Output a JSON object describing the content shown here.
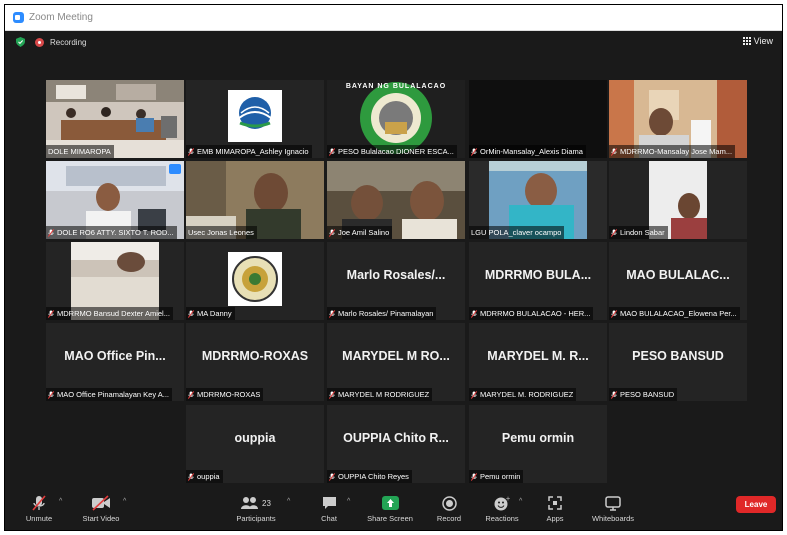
{
  "window": {
    "title": "Zoom Meeting"
  },
  "topbar": {
    "recording_label": "Recording",
    "view_label": "View"
  },
  "participants": [
    {
      "id": "p1",
      "name": "DOLE MIMAROPA",
      "muted": false,
      "display": "video"
    },
    {
      "id": "p2",
      "name": "EMB MIMAROPA_Ashley Ignacio",
      "muted": true,
      "display": "logo"
    },
    {
      "id": "p3",
      "name": "PESO Bulalacao DIONER ESCA...",
      "muted": true,
      "display": "logo",
      "logo_text": "BAYAN NG BULALACAO"
    },
    {
      "id": "p4",
      "name": "OrMin-Mansalay_Alexis Diama",
      "muted": true,
      "display": "blank"
    },
    {
      "id": "p5",
      "name": "MDRRMO-Mansalay Jose Mam...",
      "muted": true,
      "display": "video"
    },
    {
      "id": "p6",
      "name": "DOLE RO6 ATTY. SIXTO T. ROD...",
      "muted": true,
      "display": "video"
    },
    {
      "id": "p7",
      "name": "Usec Jonas Leones",
      "muted": false,
      "display": "video",
      "active": true
    },
    {
      "id": "p8",
      "name": "Joe Amil Salino",
      "muted": true,
      "display": "video"
    },
    {
      "id": "p9",
      "name": "LGU POLA_claver ocampo",
      "muted": false,
      "display": "video"
    },
    {
      "id": "p10",
      "name": "Lindon Sabar",
      "muted": true,
      "display": "video"
    },
    {
      "id": "p11",
      "name": "MDRRMO Bansud Dexter Amiel...",
      "muted": true,
      "display": "video"
    },
    {
      "id": "p12",
      "name": "MA Danny",
      "muted": true,
      "display": "logo"
    },
    {
      "id": "p13",
      "name": "Marlo Rosales/ Pinamalayan",
      "muted": true,
      "display": "name",
      "big": "Marlo Rosales/..."
    },
    {
      "id": "p14",
      "name": "MDRRMO BULALACAO - HER...",
      "muted": true,
      "display": "name",
      "big": "MDRRMO BULA..."
    },
    {
      "id": "p15",
      "name": "MAO BULALACAO_Elowena Per...",
      "muted": true,
      "display": "name",
      "big": "MAO BULALAC..."
    },
    {
      "id": "p16",
      "name": "MAO Office Pinamalayan Key A...",
      "muted": true,
      "display": "name",
      "big": "MAO Office Pin..."
    },
    {
      "id": "p17",
      "name": "MDRRMO-ROXAS",
      "muted": true,
      "display": "name",
      "big": "MDRRMO-ROXAS"
    },
    {
      "id": "p18",
      "name": "MARYDEL M RODRIGUEZ",
      "muted": true,
      "display": "name",
      "big": "MARYDEL M RO..."
    },
    {
      "id": "p19",
      "name": "MARYDEL M. RODRIGUEZ",
      "muted": true,
      "display": "name",
      "big": "MARYDEL M. R..."
    },
    {
      "id": "p20",
      "name": "PESO BANSUD",
      "muted": true,
      "display": "name",
      "big": "PESO BANSUD"
    },
    {
      "id": "p21",
      "name": "ouppia",
      "muted": true,
      "display": "name",
      "big": "ouppia"
    },
    {
      "id": "p22",
      "name": "OUPPIA Chito Reyes",
      "muted": true,
      "display": "name",
      "big": "OUPPIA Chito R..."
    },
    {
      "id": "p23",
      "name": "Pemu ormin",
      "muted": true,
      "display": "name",
      "big": "Pemu ormin"
    }
  ],
  "toolbar": {
    "unmute": "Unmute",
    "start_video": "Start Video",
    "participants": "Participants",
    "participant_count": "23",
    "chat": "Chat",
    "share_screen": "Share Screen",
    "record": "Record",
    "reactions": "Reactions",
    "apps": "Apps",
    "whiteboards": "Whiteboards",
    "leave": "Leave"
  },
  "colors": {
    "active_speaker": "#c6e04a",
    "share_green": "#23a455",
    "leave_red": "#e02828",
    "mute_red": "#e23c3c"
  }
}
